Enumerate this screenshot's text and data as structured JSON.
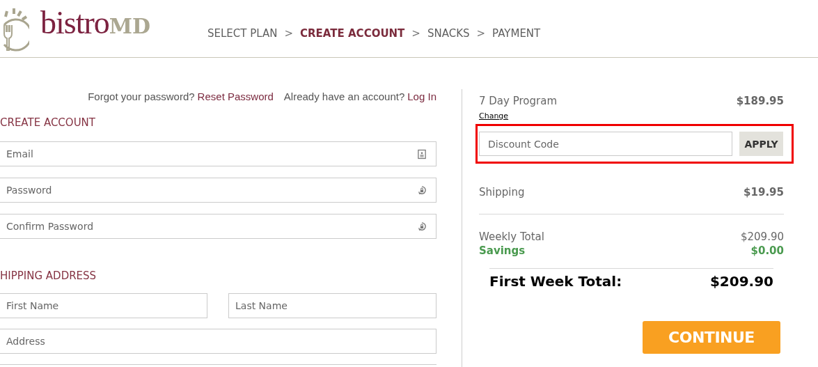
{
  "logo": {
    "name": "bistro",
    "suffix": "MD"
  },
  "steps": [
    {
      "label": "SELECT PLAN",
      "selected": false,
      "separator": ">"
    },
    {
      "label": "CREATE ACCOUNT",
      "selected": true,
      "separator": ">"
    },
    {
      "label": "SNACKS",
      "selected": false,
      "separator": ">"
    },
    {
      "label": "PAYMENT",
      "selected": false
    }
  ],
  "account_links": [
    {
      "prompt": "Forgot your password?",
      "link": "Reset Password"
    },
    {
      "prompt": "Already have an account?",
      "link": "Log In"
    }
  ],
  "create_account": {
    "heading": "CREATE ACCOUNT",
    "fields": [
      {
        "placeholder": "Email",
        "kind": "email"
      },
      {
        "placeholder": "Password",
        "kind": "password"
      },
      {
        "placeholder": "Confirm Password",
        "kind": "password"
      }
    ]
  },
  "shipping_address": {
    "heading": "HIPPING ADDRESS",
    "rows": [
      [
        {
          "placeholder": "First Name"
        },
        {
          "placeholder": "Last Name"
        }
      ],
      [
        {
          "placeholder": "Address"
        }
      ]
    ]
  },
  "summary": {
    "plan": {
      "name": "7 Day Program",
      "price": "$189.95",
      "change_link": "Change"
    },
    "discount": {
      "placeholder": "Discount Code",
      "button": "APPLY",
      "highlighted": true
    },
    "shipping": {
      "label": "Shipping",
      "amount": "$19.95"
    },
    "weekly_total": {
      "label": "Weekly Total",
      "amount": "$209.90"
    },
    "savings": {
      "label": "Savings",
      "amount": "$0.00"
    },
    "first_week_total": {
      "label": "First Week Total:",
      "amount": "$209.90"
    },
    "continue_button": "CONTINUE"
  }
}
